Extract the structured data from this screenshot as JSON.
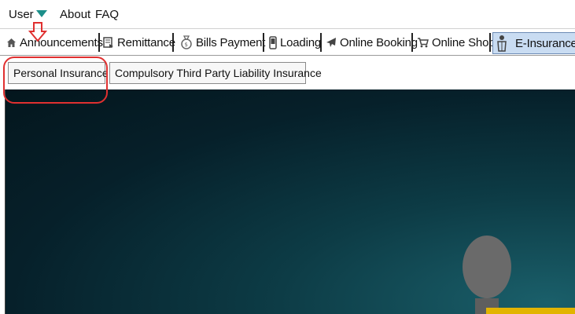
{
  "menubar": {
    "user": "User",
    "about": "About",
    "faq": "FAQ"
  },
  "tabs": [
    {
      "label": "Announcements",
      "icon": "home-icon"
    },
    {
      "label": "Remittance",
      "icon": "remittance-icon"
    },
    {
      "label": "Bills Payment",
      "icon": "bills-icon"
    },
    {
      "label": "Loading",
      "icon": "phone-icon"
    },
    {
      "label": "Online Booking",
      "icon": "airplane-icon"
    },
    {
      "label": "Online Shop",
      "icon": "cart-icon"
    },
    {
      "label": "E-Insurance",
      "icon": "insurance-icon",
      "active": true
    }
  ],
  "subtabs": [
    {
      "label": "Personal Insurance"
    },
    {
      "label": "Compulsory Third Party Liability Insurance"
    }
  ],
  "colors": {
    "accent": "#1c8f8a",
    "annotation": "#e03030",
    "active_tab": "#c9dcf2"
  }
}
